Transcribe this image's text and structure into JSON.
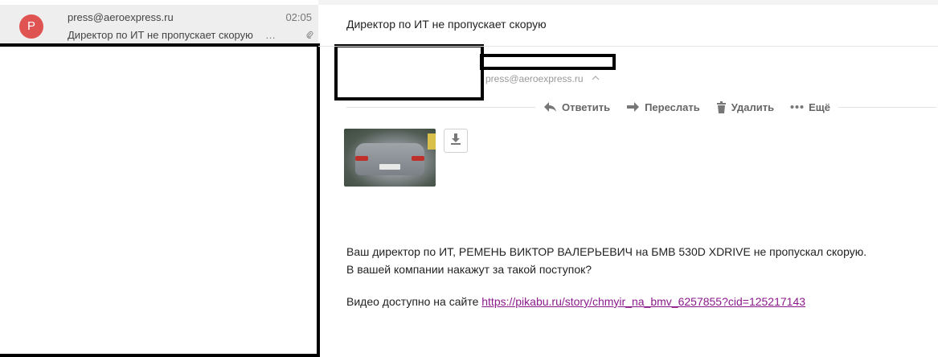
{
  "list": {
    "items": [
      {
        "avatar_letter": "P",
        "sender": "press@aeroexpress.ru",
        "time": "02:05",
        "subject": "Директор по ИТ не пропускает скорую",
        "ellipsis": "…"
      }
    ]
  },
  "message": {
    "title": "Директор по ИТ не пропускает скорую",
    "from_address": "press@aeroexpress.ru",
    "body_line1": "Ваш директор по ИТ, РЕМЕНЬ ВИКТОР ВАЛЕРЬЕВИЧ на БМВ 530D XDRIVE не пропускал скорую.",
    "body_line2": "В вашей компании накажут за такой поступок?",
    "video_prefix": "Видео доступно на сайте ",
    "video_link": "https://pikabu.ru/story/chmyir_na_bmv_6257855?cid=125217143"
  },
  "actions": {
    "reply": "Ответить",
    "forward": "Переслать",
    "delete": "Удалить",
    "more": "Ещё"
  },
  "colors": {
    "avatar": "#e05353",
    "link": "#8b1a8b",
    "selected_row": "#eeeeee"
  }
}
